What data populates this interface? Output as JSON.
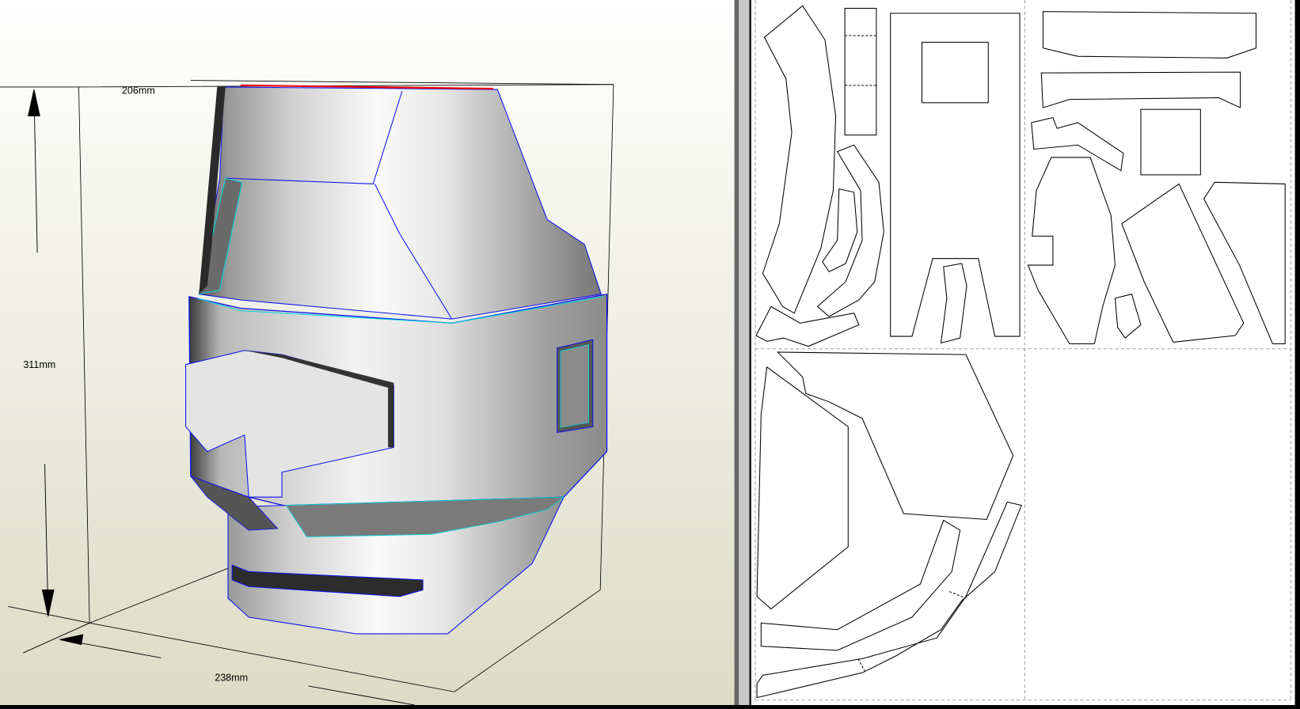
{
  "viewport3d": {
    "dimensions": {
      "width": "206mm",
      "height": "311mm",
      "depth": "238mm"
    },
    "colors": {
      "background_top": "#ffffff",
      "background_bottom": "#dcdcc6",
      "edge_blue": "#1010ee",
      "edge_cyan": "#00d8d8",
      "edge_red": "#ee0000"
    }
  },
  "viewport2d": {
    "colors": {
      "background": "#ffffff",
      "page_border": "#a0a0a0",
      "part_outline": "#000000"
    }
  }
}
